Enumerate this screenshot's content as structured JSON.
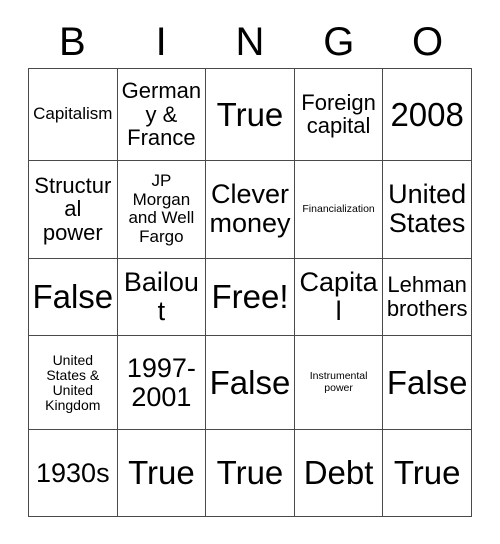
{
  "card": {
    "title": "BINGO",
    "header_letters": [
      "B",
      "I",
      "N",
      "G",
      "O"
    ],
    "free_space": "Free!",
    "rows": [
      [
        {
          "text": "Capitalism",
          "size": "sm"
        },
        {
          "text": "Germany & France",
          "size": "md"
        },
        {
          "text": "True",
          "size": "xl"
        },
        {
          "text": "Foreign capital",
          "size": "md"
        },
        {
          "text": "2008",
          "size": "xl"
        }
      ],
      [
        {
          "text": "Structural power",
          "size": "md"
        },
        {
          "text": "JP Morgan and Well Fargo",
          "size": "sm"
        },
        {
          "text": "Clever money",
          "size": "lg"
        },
        {
          "text": "Financialization",
          "size": "xxs"
        },
        {
          "text": "United States",
          "size": "lg"
        }
      ],
      [
        {
          "text": "False",
          "size": "xl"
        },
        {
          "text": "Bailout",
          "size": "lg"
        },
        {
          "text": "Free!",
          "size": "xl"
        },
        {
          "text": "Capital",
          "size": "lg"
        },
        {
          "text": "Lehman brothers",
          "size": "md"
        }
      ],
      [
        {
          "text": "United States & United Kingdom",
          "size": "xs"
        },
        {
          "text": "1997-2001",
          "size": "lg"
        },
        {
          "text": "False",
          "size": "xl"
        },
        {
          "text": "Instrumental power",
          "size": "xxs"
        },
        {
          "text": "False",
          "size": "xl"
        }
      ],
      [
        {
          "text": "1930s",
          "size": "lg"
        },
        {
          "text": "True",
          "size": "xl"
        },
        {
          "text": "True",
          "size": "xl"
        },
        {
          "text": "Debt",
          "size": "xl"
        },
        {
          "text": "True",
          "size": "xl"
        }
      ]
    ]
  },
  "colors": {
    "background": "#ffffff",
    "text": "#000000",
    "grid_line": "#4a4a4a"
  }
}
